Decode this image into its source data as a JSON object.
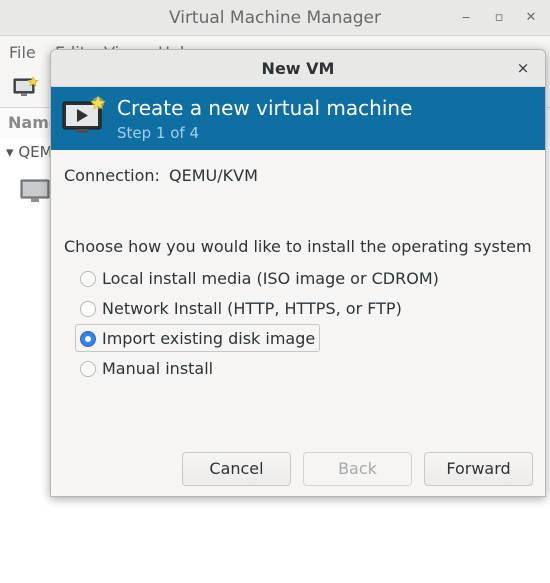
{
  "main_window": {
    "title": "Virtual Machine Manager",
    "menu": [
      "File",
      "Edit",
      "View",
      "Help"
    ],
    "list_header": "Name",
    "connection_row": "QEMU"
  },
  "dialog": {
    "title": "New VM",
    "close_label": "×",
    "banner": {
      "title": "Create a new virtual machine",
      "step": "Step 1 of 4",
      "color": "#0f6ea2"
    },
    "connection_label": "Connection:",
    "connection_value": "QEMU/KVM",
    "prompt": "Choose how you would like to install the operating system",
    "options": [
      {
        "label": "Local install media (ISO image or CDROM)",
        "checked": false
      },
      {
        "label": "Network Install (HTTP, HTTPS, or FTP)",
        "checked": false
      },
      {
        "label": "Import existing disk image",
        "checked": true
      },
      {
        "label": "Manual install",
        "checked": false
      }
    ],
    "buttons": {
      "cancel": "Cancel",
      "back": "Back",
      "forward": "Forward"
    }
  }
}
